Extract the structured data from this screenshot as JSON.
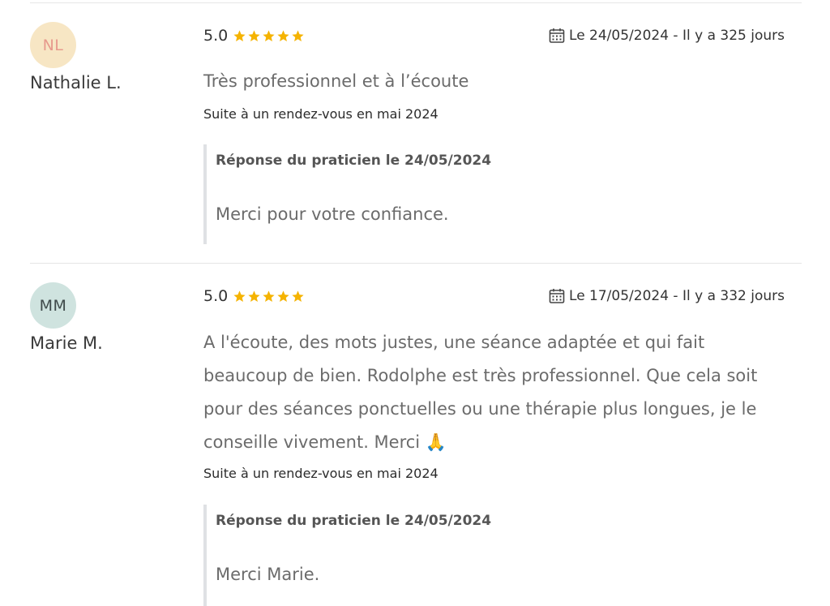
{
  "colors": {
    "star": "#f5b301",
    "avatar_nl_bg": "#f7e6c4",
    "avatar_nl_fg": "#e79a8d",
    "avatar_mm_bg": "#cfe3df",
    "avatar_mm_fg": "#3f4a4a"
  },
  "reviews": [
    {
      "initials": "NL",
      "author": "Nathalie L.",
      "rating": "5.0",
      "stars": 5,
      "date": "Le 24/05/2024 - Il y a 325 jours",
      "title": "Très professionnel et à l’écoute",
      "visit": "Suite à un rendez-vous en mai 2024",
      "reply_header": "Réponse du praticien le 24/05/2024",
      "reply_body": "Merci pour votre confiance."
    },
    {
      "initials": "MM",
      "author": "Marie M.",
      "rating": "5.0",
      "stars": 5,
      "date": "Le 17/05/2024 - Il y a 332 jours",
      "body": "A l'écoute, des mots justes, une séance adaptée et qui fait beaucoup de bien. Rodolphe est très professionnel. Que cela soit pour des séances ponctuelles ou une thérapie plus longues, je le conseille vivement. Merci 🙏",
      "visit": "Suite à un rendez-vous en mai 2024",
      "reply_header": "Réponse du praticien le 24/05/2024",
      "reply_body": "Merci Marie."
    }
  ]
}
